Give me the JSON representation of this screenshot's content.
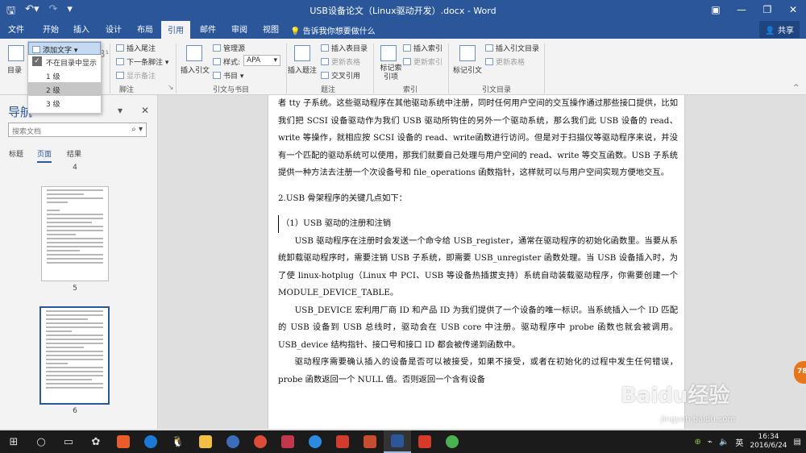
{
  "title_bar": {
    "document_title": "USB设备论文（Linux驱动开发）.docx - Word",
    "qat_icons": [
      "save-icon",
      "undo-icon",
      "redo-icon",
      "customize-icon"
    ],
    "window_buttons": [
      "ribbon-options-icon",
      "minimize-icon",
      "maximize-icon",
      "close-icon"
    ]
  },
  "tabs": [
    "文件",
    "开始",
    "插入",
    "设计",
    "布局",
    "引用",
    "邮件",
    "审阅",
    "视图"
  ],
  "active_tab": "引用",
  "tell_me": "告诉我你想要做什么",
  "share": "共享",
  "ribbon": {
    "toc": {
      "label": "目录",
      "add_text": "添加文字",
      "group": "目录"
    },
    "footnotes": {
      "insert_endnote": "插入尾注",
      "next_footnote": "下一条脚注",
      "show_notes": "显示备注",
      "group": "脚注"
    },
    "citations": {
      "insert_citation": "插入引文",
      "manage_sources": "管理源",
      "style_label": "样式:",
      "style_value": "APA",
      "bibliography": "书目",
      "group": "引文与书目"
    },
    "captions": {
      "insert_caption": "插入题注",
      "insert_table_of_figures": "插入表目录",
      "update_table": "更新表格",
      "cross_reference": "交叉引用",
      "group": "题注"
    },
    "index": {
      "mark_entry": "标记索引项",
      "insert_index": "插入索引",
      "update_index": "更新索引",
      "group": "索引"
    },
    "authorities": {
      "mark_citation": "标记引文",
      "insert_table": "插入引文目录",
      "update_table": "更新表格",
      "group": "引文目录"
    }
  },
  "add_text_menu": {
    "items": [
      "不在目录中显示",
      "1 级",
      "2 级",
      "3 级"
    ],
    "checked_index": 0,
    "hover_index": 2
  },
  "nav_pane": {
    "title": "导航",
    "search_placeholder": "搜索文档",
    "tabs": [
      "标题",
      "页面",
      "结果"
    ],
    "active_tab": 1,
    "page_numbers": [
      "4",
      "5",
      "6"
    ],
    "selected_page": "6"
  },
  "document": {
    "paragraphs": [
      "者 tty 子系统。这些驱动程序在其他驱动系统中注册，同时任何用户空间的交互操作通过那些接口提供，比如我们把 SCSI 设备驱动作为我们 USB 驱动所钩住的另外一个驱动系统，那么我们此 USB 设备的 read、write 等操作，就相应按 SCSI 设备的 read、write函数进行访问。但是对于扫描仪等驱动程序来说，并没有一个匹配的驱动系统可以使用，那我们就要自己处理与用户空间的 read、write 等交互函数。USB 子系统提供一种方法去注册一个次设备号和 file_operations 函数指针，这样就可以与用户空间实现方便地交互。",
      "2.USB 骨架程序的关键几点如下：",
      "（1）USB 驱动的注册和注销",
      "USB 驱动程序在注册时会发送一个命令给 USB_register，通常在驱动程序的初始化函数里。当要从系统卸载驱动程序时，需要注销 USB 子系统，即需要 USB_unregister 函数处理。当 USB 设备插入时，为了使 linux-hotplug（Linux 中 PCI、USB 等设备热插拔支持）系统自动装载驱动程序，你需要创建一个 MODULE_DEVICE_TABLE。",
      "USB_DEVICE 宏利用厂商 ID 和产品 ID 为我们提供了一个设备的唯一标识。当系统插入一个 ID 匹配的 USB 设备到 USB 总线时，驱动会在 USB core 中注册。驱动程序中 probe 函数也就会被调用。USB_device 结构指针、接口号和接口 ID 都会被传递到函数中。",
      "驱动程序需要确认插入的设备是否可以被接受，如果不接受，或者在初始化的过程中发生任何错误，probe 函数返回一个 NULL 值。否则返回一个含有设备"
    ]
  },
  "side_badge": "78",
  "watermark": {
    "brand": "Baidu经验",
    "url": "jingyan.baidu.com"
  },
  "taskbar": {
    "apps": [
      "windows-start-icon",
      "cortana-icon",
      "task-view-icon",
      "app-icon",
      "store-icon",
      "kugou-icon",
      "qq-icon",
      "explorer-icon",
      "browser-icon",
      "chrome-icon",
      "app2-icon",
      "video-icon",
      "pdf-icon",
      "app3-icon",
      "word-icon",
      "app4-icon",
      "wechat-icon"
    ],
    "ime": "英",
    "time": "16:34",
    "date": "2016/6/24"
  }
}
